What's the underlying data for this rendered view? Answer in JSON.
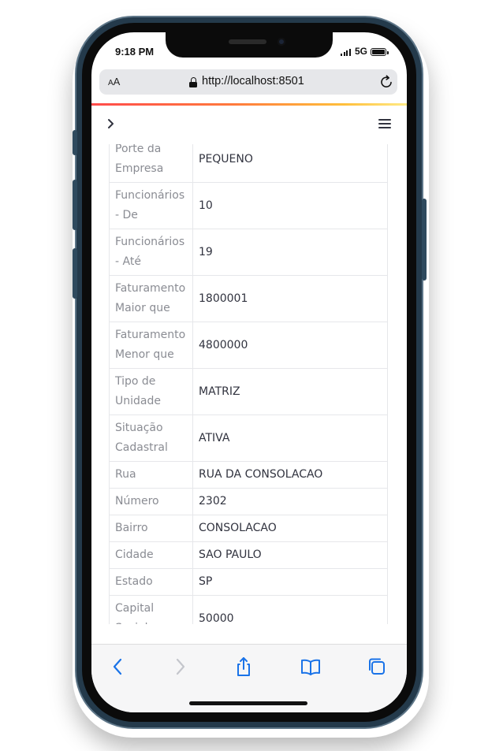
{
  "status_bar": {
    "time": "9:18 PM",
    "network": "5G"
  },
  "address_bar": {
    "text_size_small": "A",
    "text_size_large": "A",
    "url": "http://localhost:8501"
  },
  "colors": {
    "frame": "#243a4b",
    "accent_blue": "#1a73e8",
    "progress_gradient": [
      "#ff4b4b",
      "#ffbf3c",
      "#ffea85"
    ],
    "label_text": "#8a8c93",
    "value_text": "#31333f"
  },
  "icons": {
    "sidebar_toggle": "chevron-right-icon",
    "menu": "hamburger-menu-icon",
    "reload": "reload-icon",
    "lock": "lock-icon",
    "toolbar": [
      "back-icon",
      "forward-icon",
      "share-icon",
      "bookmarks-icon",
      "tabs-icon"
    ]
  },
  "table": {
    "rows": [
      {
        "label": "Porte da Empresa",
        "value": "PEQUENO"
      },
      {
        "label": "Funcionários - De",
        "value": "10"
      },
      {
        "label": "Funcionários - Até",
        "value": "19"
      },
      {
        "label": "Faturamento Maior que",
        "value": "1800001"
      },
      {
        "label": "Faturamento Menor que",
        "value": "4800000"
      },
      {
        "label": "Tipo de Unidade",
        "value": "MATRIZ"
      },
      {
        "label": "Situação Cadastral",
        "value": "ATIVA"
      },
      {
        "label": "Rua",
        "value": "RUA DA CONSOLACAO"
      },
      {
        "label": "Número",
        "value": "2302"
      },
      {
        "label": "Bairro",
        "value": "CONSOLACAO"
      },
      {
        "label": "Cidade",
        "value": "SAO PAULO"
      },
      {
        "label": "Estado",
        "value": "SP"
      },
      {
        "label": "Capital Social",
        "value": "50000"
      }
    ]
  }
}
